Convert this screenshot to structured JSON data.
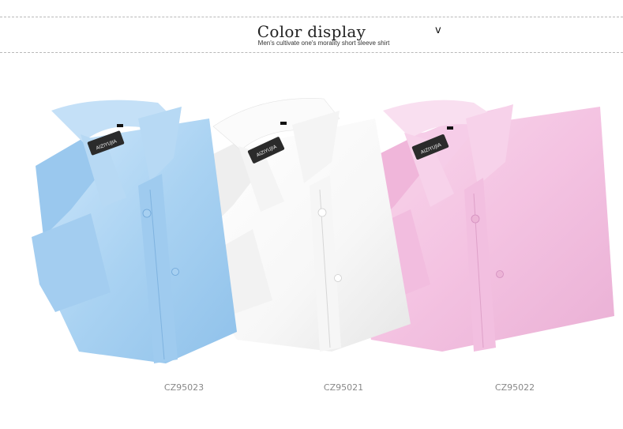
{
  "header": {
    "title": "Color display",
    "subtitle": "Men's cultivate one's morality short sleeve shirt",
    "chevron_icon": "chevron-down-icon",
    "chevron_glyph": "v"
  },
  "products": [
    {
      "code": "CZ95023",
      "color": "#a9d2f2",
      "shade": "#85b8e6",
      "label_text": "AIZIYUJIA"
    },
    {
      "code": "CZ95021",
      "color": "#fafafa",
      "shade": "#dcdcdc",
      "label_text": "AIZIYUJIA"
    },
    {
      "code": "CZ95022",
      "color": "#f4c3e2",
      "shade": "#e5a2cc",
      "label_text": "AIZIYUJIA"
    }
  ]
}
